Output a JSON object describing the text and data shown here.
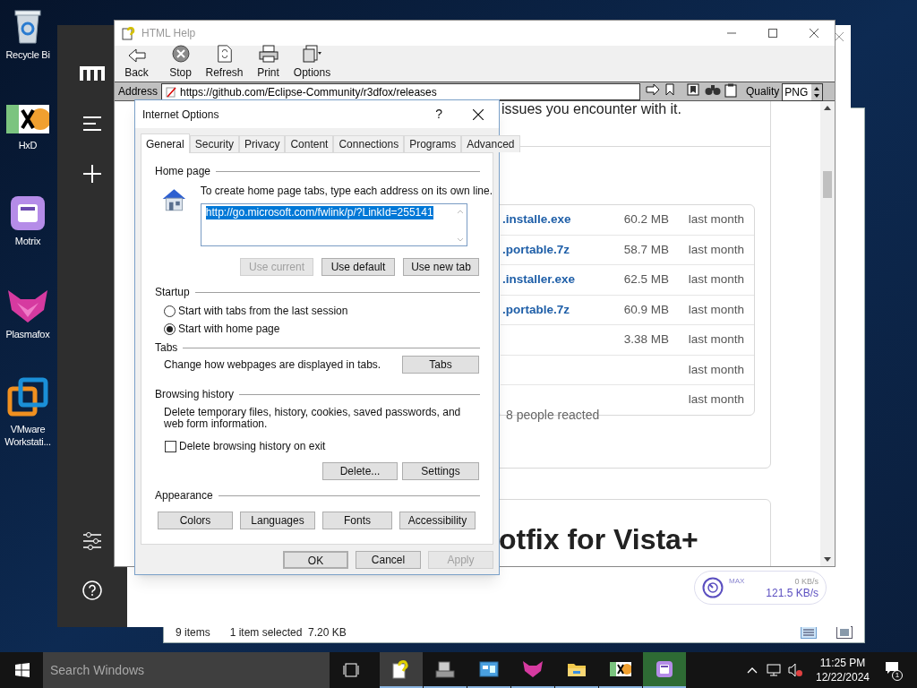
{
  "desktop_icons": [
    {
      "kind": "recycle",
      "label": "Recycle Bi"
    },
    {
      "kind": "hxd",
      "label": "HxD"
    },
    {
      "kind": "motrix",
      "label": "Motrix"
    },
    {
      "kind": "plasmafox",
      "label": "Plasmafox"
    },
    {
      "kind": "vmware",
      "label": "VMware Workstati..."
    }
  ],
  "explorer": {
    "status_items": "9 items",
    "status_selection": "1 item selected  7.20 KB"
  },
  "motrix": {
    "speed_label": "MAX",
    "upload_speed": "0 KB/s",
    "download_speed": "121.5 KB/s"
  },
  "help_window": {
    "title": "HTML Help",
    "toolbar": [
      {
        "kind": "back",
        "label": "Back"
      },
      {
        "kind": "stop",
        "label": "Stop"
      },
      {
        "kind": "refresh",
        "label": "Refresh"
      },
      {
        "kind": "print",
        "label": "Print"
      },
      {
        "kind": "options",
        "label": "Options"
      }
    ],
    "address_label": "Address",
    "address": "https://github.com/Eclipse-Community/r3dfox/releases",
    "quality_label": "Quality",
    "quality": "PNG",
    "page": {
      "text": "issues you encounter with it.",
      "assets": [
        {
          "name": ".installe.exe",
          "size": "60.2 MB",
          "date": "last month"
        },
        {
          "name": ".portable.7z",
          "size": "58.7 MB",
          "date": "last month"
        },
        {
          "name": ".installer.exe",
          "size": "62.5 MB",
          "date": "last month"
        },
        {
          "name": ".portable.7z",
          "size": "60.9 MB",
          "date": "last month"
        },
        {
          "size": "3.38 MB",
          "date": "last month"
        },
        {
          "date": "last month"
        },
        {
          "date": "last month"
        }
      ],
      "reactions": "8 people reacted",
      "heading": "otfix for Vista+"
    }
  },
  "dialog": {
    "title": "Internet Options",
    "help": "?",
    "tabs": [
      {
        "label": "General",
        "selected": true
      },
      {
        "label": "Security",
        "selected": false
      },
      {
        "label": "Privacy",
        "selected": false
      },
      {
        "label": "Content",
        "selected": false
      },
      {
        "label": "Connections",
        "selected": false
      },
      {
        "label": "Programs",
        "selected": false
      },
      {
        "label": "Advanced",
        "selected": false
      }
    ],
    "home_page": {
      "label": "Home page",
      "instruction": "To create home page tabs, type each address on its own line.",
      "value": "http://go.microsoft.com/fwlink/p/?LinkId=255141",
      "buttons": [
        {
          "label": "Use current",
          "disabled": true
        },
        {
          "label": "Use default",
          "disabled": false
        },
        {
          "label": "Use new tab",
          "disabled": false
        }
      ]
    },
    "startup": {
      "label": "Startup",
      "options": [
        {
          "label": "Start with tabs from the last session",
          "selected": false
        },
        {
          "label": "Start with home page",
          "selected": true
        }
      ]
    },
    "tabs_section": {
      "label": "Tabs",
      "description": "Change how webpages are displayed in tabs.",
      "button": "Tabs"
    },
    "browsing_history": {
      "label": "Browsing history",
      "description": "Delete temporary files, history, cookies, saved passwords, and web form information.",
      "checkbox": {
        "label": "Delete browsing history on exit",
        "checked": false
      },
      "buttons": [
        "Delete...",
        "Settings"
      ]
    },
    "appearance": {
      "label": "Appearance",
      "buttons": [
        "Colors",
        "Languages",
        "Fonts",
        "Accessibility"
      ]
    },
    "footer": [
      {
        "label": "OK",
        "default": true,
        "disabled": false
      },
      {
        "label": "Cancel",
        "default": false,
        "disabled": false
      },
      {
        "label": "Apply",
        "default": false,
        "disabled": true
      }
    ]
  },
  "taskbar": {
    "search_placeholder": "Search Windows",
    "apps": [
      {
        "kind": "help",
        "selected": true
      },
      {
        "kind": "setup",
        "selected": false
      },
      {
        "kind": "monitor",
        "selected": false
      },
      {
        "kind": "plasmafox",
        "selected": false
      },
      {
        "kind": "folder",
        "selected": false
      },
      {
        "kind": "hxd",
        "selected": false
      },
      {
        "kind": "motrix",
        "selected": false
      }
    ],
    "time": "11:25 PM",
    "date": "12/22/2024",
    "notifications": "1"
  }
}
